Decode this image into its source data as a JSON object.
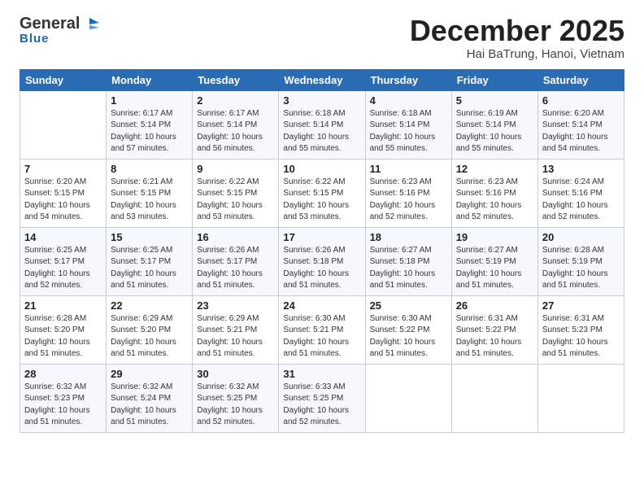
{
  "header": {
    "logo_general": "General",
    "logo_blue": "Blue",
    "month_title": "December 2025",
    "location": "Hai BaTrung, Hanoi, Vietnam"
  },
  "weekdays": [
    "Sunday",
    "Monday",
    "Tuesday",
    "Wednesday",
    "Thursday",
    "Friday",
    "Saturday"
  ],
  "weeks": [
    [
      {
        "day": "",
        "detail": ""
      },
      {
        "day": "1",
        "detail": "Sunrise: 6:17 AM\nSunset: 5:14 PM\nDaylight: 10 hours\nand 57 minutes."
      },
      {
        "day": "2",
        "detail": "Sunrise: 6:17 AM\nSunset: 5:14 PM\nDaylight: 10 hours\nand 56 minutes."
      },
      {
        "day": "3",
        "detail": "Sunrise: 6:18 AM\nSunset: 5:14 PM\nDaylight: 10 hours\nand 55 minutes."
      },
      {
        "day": "4",
        "detail": "Sunrise: 6:18 AM\nSunset: 5:14 PM\nDaylight: 10 hours\nand 55 minutes."
      },
      {
        "day": "5",
        "detail": "Sunrise: 6:19 AM\nSunset: 5:14 PM\nDaylight: 10 hours\nand 55 minutes."
      },
      {
        "day": "6",
        "detail": "Sunrise: 6:20 AM\nSunset: 5:14 PM\nDaylight: 10 hours\nand 54 minutes."
      }
    ],
    [
      {
        "day": "7",
        "detail": "Sunrise: 6:20 AM\nSunset: 5:15 PM\nDaylight: 10 hours\nand 54 minutes."
      },
      {
        "day": "8",
        "detail": "Sunrise: 6:21 AM\nSunset: 5:15 PM\nDaylight: 10 hours\nand 53 minutes."
      },
      {
        "day": "9",
        "detail": "Sunrise: 6:22 AM\nSunset: 5:15 PM\nDaylight: 10 hours\nand 53 minutes."
      },
      {
        "day": "10",
        "detail": "Sunrise: 6:22 AM\nSunset: 5:15 PM\nDaylight: 10 hours\nand 53 minutes."
      },
      {
        "day": "11",
        "detail": "Sunrise: 6:23 AM\nSunset: 5:16 PM\nDaylight: 10 hours\nand 52 minutes."
      },
      {
        "day": "12",
        "detail": "Sunrise: 6:23 AM\nSunset: 5:16 PM\nDaylight: 10 hours\nand 52 minutes."
      },
      {
        "day": "13",
        "detail": "Sunrise: 6:24 AM\nSunset: 5:16 PM\nDaylight: 10 hours\nand 52 minutes."
      }
    ],
    [
      {
        "day": "14",
        "detail": "Sunrise: 6:25 AM\nSunset: 5:17 PM\nDaylight: 10 hours\nand 52 minutes."
      },
      {
        "day": "15",
        "detail": "Sunrise: 6:25 AM\nSunset: 5:17 PM\nDaylight: 10 hours\nand 51 minutes."
      },
      {
        "day": "16",
        "detail": "Sunrise: 6:26 AM\nSunset: 5:17 PM\nDaylight: 10 hours\nand 51 minutes."
      },
      {
        "day": "17",
        "detail": "Sunrise: 6:26 AM\nSunset: 5:18 PM\nDaylight: 10 hours\nand 51 minutes."
      },
      {
        "day": "18",
        "detail": "Sunrise: 6:27 AM\nSunset: 5:18 PM\nDaylight: 10 hours\nand 51 minutes."
      },
      {
        "day": "19",
        "detail": "Sunrise: 6:27 AM\nSunset: 5:19 PM\nDaylight: 10 hours\nand 51 minutes."
      },
      {
        "day": "20",
        "detail": "Sunrise: 6:28 AM\nSunset: 5:19 PM\nDaylight: 10 hours\nand 51 minutes."
      }
    ],
    [
      {
        "day": "21",
        "detail": "Sunrise: 6:28 AM\nSunset: 5:20 PM\nDaylight: 10 hours\nand 51 minutes."
      },
      {
        "day": "22",
        "detail": "Sunrise: 6:29 AM\nSunset: 5:20 PM\nDaylight: 10 hours\nand 51 minutes."
      },
      {
        "day": "23",
        "detail": "Sunrise: 6:29 AM\nSunset: 5:21 PM\nDaylight: 10 hours\nand 51 minutes."
      },
      {
        "day": "24",
        "detail": "Sunrise: 6:30 AM\nSunset: 5:21 PM\nDaylight: 10 hours\nand 51 minutes."
      },
      {
        "day": "25",
        "detail": "Sunrise: 6:30 AM\nSunset: 5:22 PM\nDaylight: 10 hours\nand 51 minutes."
      },
      {
        "day": "26",
        "detail": "Sunrise: 6:31 AM\nSunset: 5:22 PM\nDaylight: 10 hours\nand 51 minutes."
      },
      {
        "day": "27",
        "detail": "Sunrise: 6:31 AM\nSunset: 5:23 PM\nDaylight: 10 hours\nand 51 minutes."
      }
    ],
    [
      {
        "day": "28",
        "detail": "Sunrise: 6:32 AM\nSunset: 5:23 PM\nDaylight: 10 hours\nand 51 minutes."
      },
      {
        "day": "29",
        "detail": "Sunrise: 6:32 AM\nSunset: 5:24 PM\nDaylight: 10 hours\nand 51 minutes."
      },
      {
        "day": "30",
        "detail": "Sunrise: 6:32 AM\nSunset: 5:25 PM\nDaylight: 10 hours\nand 52 minutes."
      },
      {
        "day": "31",
        "detail": "Sunrise: 6:33 AM\nSunset: 5:25 PM\nDaylight: 10 hours\nand 52 minutes."
      },
      {
        "day": "",
        "detail": ""
      },
      {
        "day": "",
        "detail": ""
      },
      {
        "day": "",
        "detail": ""
      }
    ]
  ]
}
